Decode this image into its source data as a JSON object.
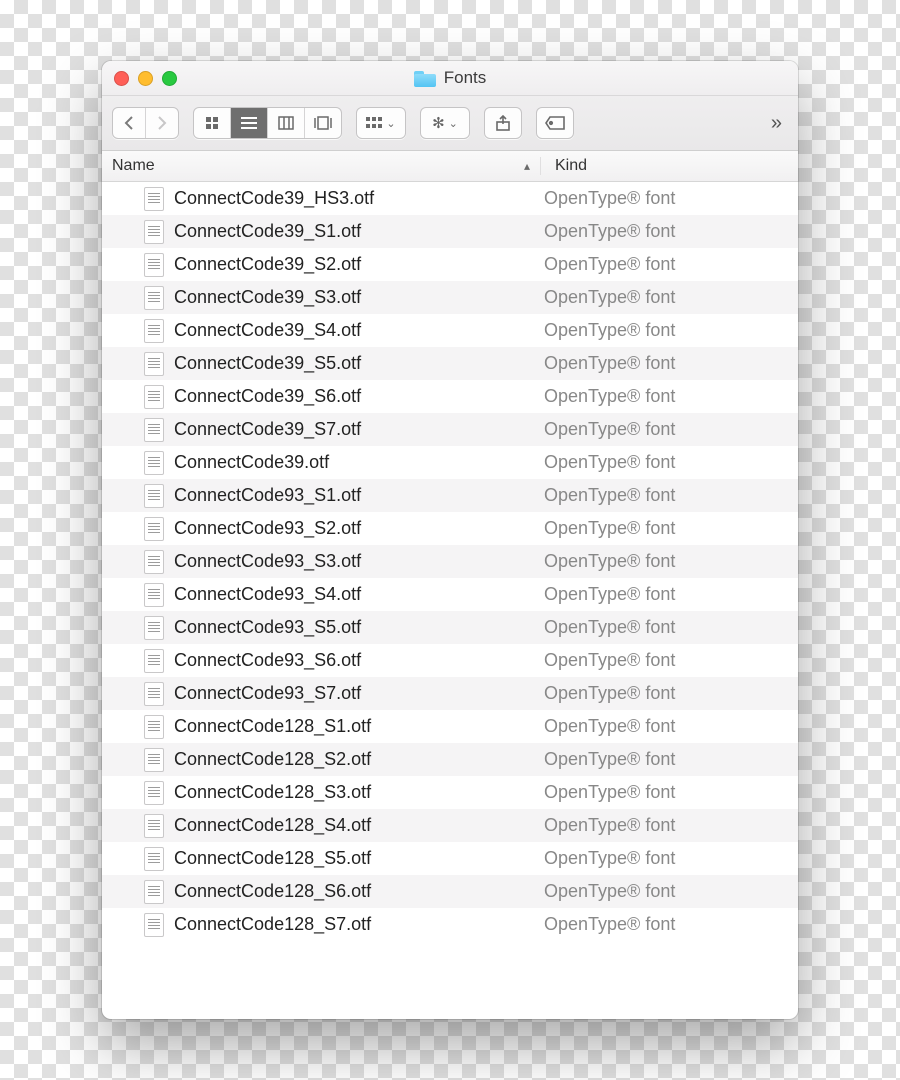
{
  "title": "Fonts",
  "columns": {
    "name": "Name",
    "kind": "Kind"
  },
  "sort_indicator": "▴",
  "overflow": "»",
  "files": [
    {
      "name": "ConnectCode39_HS3.otf",
      "kind": "OpenType® font"
    },
    {
      "name": "ConnectCode39_S1.otf",
      "kind": "OpenType® font"
    },
    {
      "name": "ConnectCode39_S2.otf",
      "kind": "OpenType® font"
    },
    {
      "name": "ConnectCode39_S3.otf",
      "kind": "OpenType® font"
    },
    {
      "name": "ConnectCode39_S4.otf",
      "kind": "OpenType® font"
    },
    {
      "name": "ConnectCode39_S5.otf",
      "kind": "OpenType® font"
    },
    {
      "name": "ConnectCode39_S6.otf",
      "kind": "OpenType® font"
    },
    {
      "name": "ConnectCode39_S7.otf",
      "kind": "OpenType® font"
    },
    {
      "name": "ConnectCode39.otf",
      "kind": "OpenType® font"
    },
    {
      "name": "ConnectCode93_S1.otf",
      "kind": "OpenType® font"
    },
    {
      "name": "ConnectCode93_S2.otf",
      "kind": "OpenType® font"
    },
    {
      "name": "ConnectCode93_S3.otf",
      "kind": "OpenType® font"
    },
    {
      "name": "ConnectCode93_S4.otf",
      "kind": "OpenType® font"
    },
    {
      "name": "ConnectCode93_S5.otf",
      "kind": "OpenType® font"
    },
    {
      "name": "ConnectCode93_S6.otf",
      "kind": "OpenType® font"
    },
    {
      "name": "ConnectCode93_S7.otf",
      "kind": "OpenType® font"
    },
    {
      "name": "ConnectCode128_S1.otf",
      "kind": "OpenType® font"
    },
    {
      "name": "ConnectCode128_S2.otf",
      "kind": "OpenType® font"
    },
    {
      "name": "ConnectCode128_S3.otf",
      "kind": "OpenType® font"
    },
    {
      "name": "ConnectCode128_S4.otf",
      "kind": "OpenType® font"
    },
    {
      "name": "ConnectCode128_S5.otf",
      "kind": "OpenType® font"
    },
    {
      "name": "ConnectCode128_S6.otf",
      "kind": "OpenType® font"
    },
    {
      "name": "ConnectCode128_S7.otf",
      "kind": "OpenType® font"
    }
  ]
}
